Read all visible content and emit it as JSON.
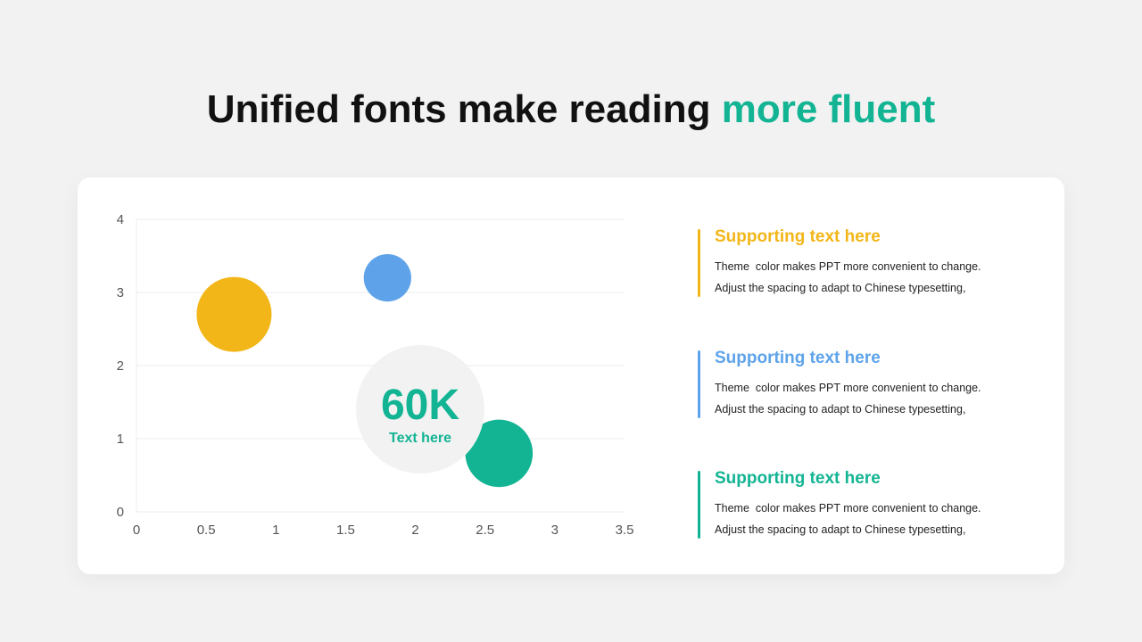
{
  "title": {
    "main": "Unified fonts make reading ",
    "accent": "more fluent"
  },
  "colors": {
    "yellow": "#f3b618",
    "blue": "#5ea3ea",
    "green": "#12b493",
    "title": "#111111",
    "grid": "#ececec",
    "center_circle": "#f2f2f2"
  },
  "callout": {
    "value": "60K",
    "label": "Text here"
  },
  "items": [
    {
      "heading": "Supporting text here",
      "color": "#f3b618",
      "line1": "Theme  color makes PPT more convenient to change.",
      "line2": "Adjust the spacing to adapt to Chinese typesetting,"
    },
    {
      "heading": "Supporting text here",
      "color": "#5ea3ea",
      "line1": "Theme  color makes PPT more convenient to change.",
      "line2": "Adjust the spacing to adapt to Chinese typesetting,"
    },
    {
      "heading": "Supporting text here",
      "color": "#12b493",
      "line1": "Theme  color makes PPT more convenient to change.",
      "line2": "Adjust the spacing to adapt to Chinese typesetting,"
    }
  ],
  "chart_data": {
    "type": "scatter",
    "title": "",
    "xlabel": "",
    "ylabel": "",
    "xlim": [
      0,
      3.5
    ],
    "ylim": [
      0,
      4
    ],
    "x_ticks": [
      "0",
      "0.5",
      "1",
      "1.5",
      "2",
      "2.5",
      "3",
      "3.5"
    ],
    "y_ticks": [
      "0",
      "1",
      "2",
      "3",
      "4"
    ],
    "grid": true,
    "legend": "none",
    "points": [
      {
        "x": 0.7,
        "y": 2.7,
        "size": 3.0,
        "color": "#f3b618"
      },
      {
        "x": 1.8,
        "y": 3.2,
        "size": 1.9,
        "color": "#5ea3ea"
      },
      {
        "x": 2.6,
        "y": 0.8,
        "size": 2.7,
        "color": "#12b493"
      }
    ]
  }
}
